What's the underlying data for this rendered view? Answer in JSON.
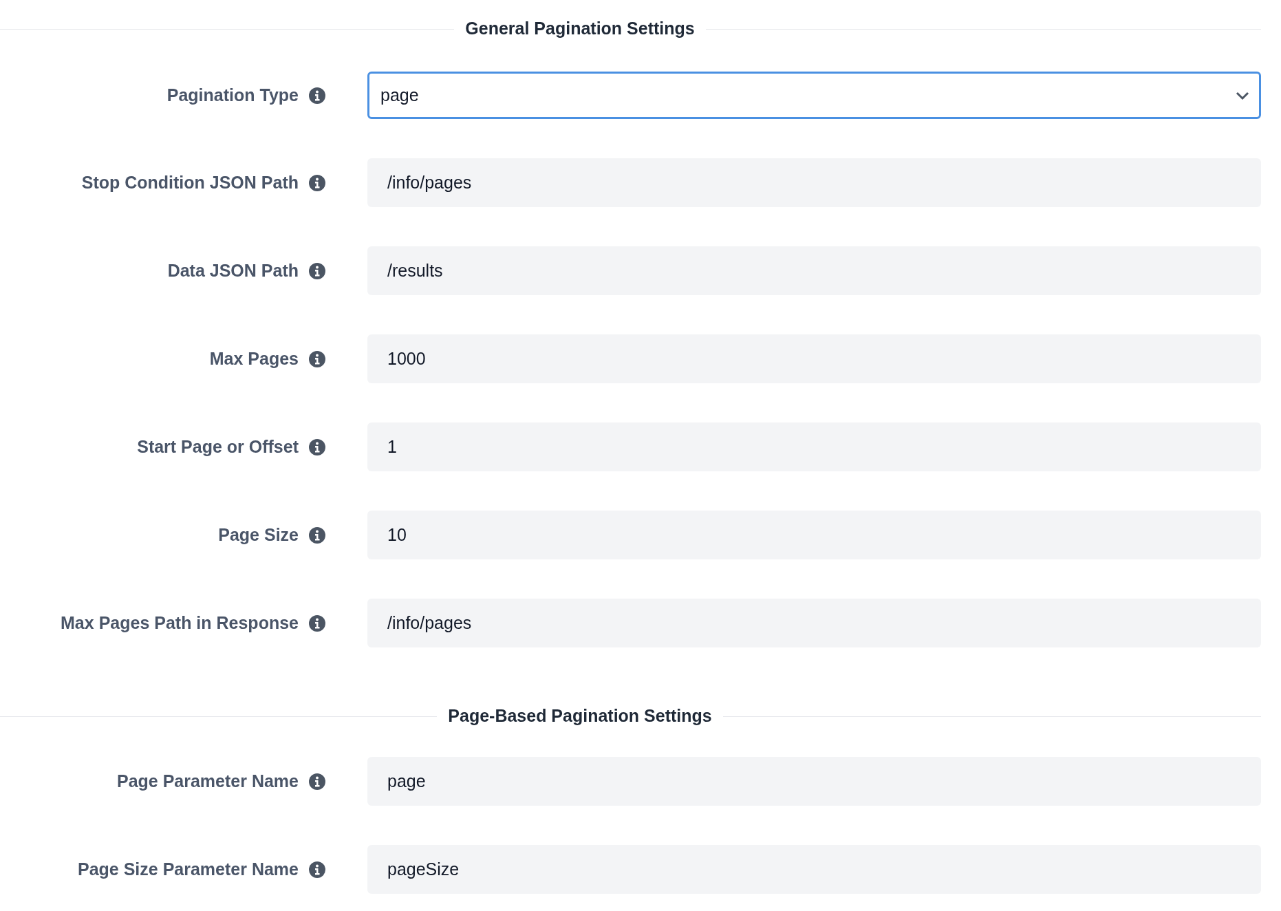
{
  "sections": [
    {
      "title": "General Pagination Settings",
      "fields": [
        {
          "kind": "select",
          "label": "Pagination Type",
          "value": "page",
          "focused": true
        },
        {
          "kind": "text",
          "label": "Stop Condition JSON Path",
          "value": "/info/pages",
          "focused": false
        },
        {
          "kind": "text",
          "label": "Data JSON Path",
          "value": "/results",
          "focused": false
        },
        {
          "kind": "text",
          "label": "Max Pages",
          "value": "1000",
          "focused": false
        },
        {
          "kind": "text",
          "label": "Start Page or Offset",
          "value": "1",
          "focused": false
        },
        {
          "kind": "text",
          "label": "Page Size",
          "value": "10",
          "focused": false
        },
        {
          "kind": "text",
          "label": "Max Pages Path in Response",
          "value": "/info/pages",
          "focused": false
        }
      ]
    },
    {
      "title": "Page-Based Pagination Settings",
      "fields": [
        {
          "kind": "text",
          "label": "Page Parameter Name",
          "value": "page",
          "focused": false
        },
        {
          "kind": "text",
          "label": "Page Size Parameter Name",
          "value": "pageSize",
          "focused": false
        }
      ]
    }
  ]
}
